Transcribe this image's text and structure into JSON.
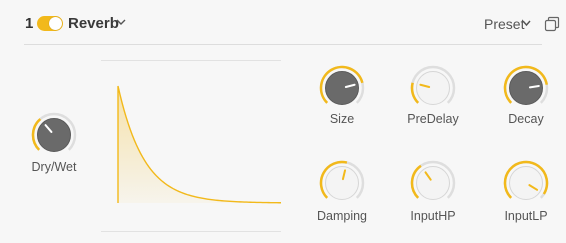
{
  "header": {
    "slot_number": "1",
    "plugin_name": "Reverb",
    "preset_label": "Preset",
    "enabled": true
  },
  "colors": {
    "accent": "#f2b91b",
    "knob_dark": "#6a6a6a",
    "knob_light": "#f4f4f4"
  },
  "knobs": {
    "dry_wet": {
      "label": "Dry/Wet",
      "value": 0.35,
      "style": "dark"
    },
    "size": {
      "label": "Size",
      "value": 0.78,
      "style": "dark"
    },
    "predelay": {
      "label": "PreDelay",
      "value": 0.22,
      "style": "light"
    },
    "decay": {
      "label": "Decay",
      "value": 0.8,
      "style": "dark"
    },
    "damping": {
      "label": "Damping",
      "value": 0.55,
      "style": "light"
    },
    "inputhp": {
      "label": "InputHP",
      "value": 0.37,
      "style": "light"
    },
    "inputlp": {
      "label": "InputLP",
      "value": 0.95,
      "style": "light"
    }
  },
  "icons": {
    "plugin_menu": "chevron-down-icon",
    "preset_menu": "chevron-down-icon",
    "copy": "copy-icon"
  }
}
